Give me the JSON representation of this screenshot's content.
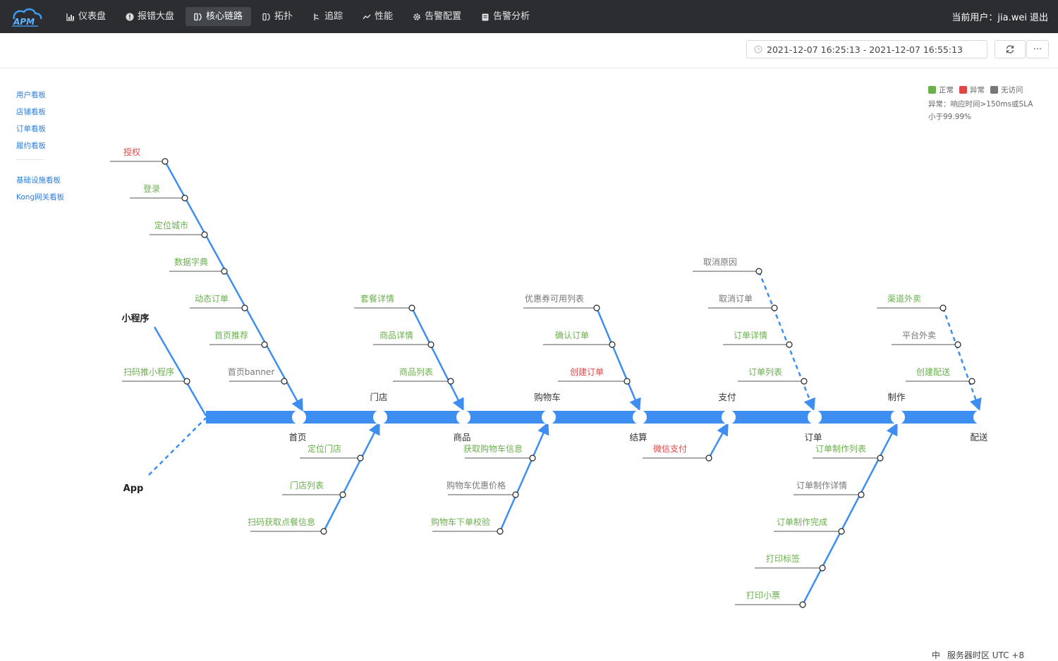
{
  "nav": {
    "logo": "APM",
    "items": [
      {
        "label": "仪表盘",
        "icon": "bar-chart-icon"
      },
      {
        "label": "报错大盘",
        "icon": "alert-circle-icon"
      },
      {
        "label": "核心链路",
        "icon": "link-icon",
        "active": true
      },
      {
        "label": "拓扑",
        "icon": "topology-icon"
      },
      {
        "label": "追踪",
        "icon": "trace-icon"
      },
      {
        "label": "性能",
        "icon": "trend-icon"
      },
      {
        "label": "告警配置",
        "icon": "gear-icon"
      },
      {
        "label": "告警分析",
        "icon": "clipboard-icon"
      }
    ],
    "user_label": "当前用户：",
    "user_name": "jia.wei",
    "logout": "退出"
  },
  "toolbar": {
    "time_range": "2021-12-07 16:25:13 - 2021-12-07 16:55:13",
    "refresh_icon": "refresh-icon",
    "more_label": "···"
  },
  "sidebar": {
    "group1": [
      "用户看板",
      "店铺看板",
      "订单看板",
      "履约看板"
    ],
    "group2": [
      "基础设施看板",
      "Kong网关看板"
    ]
  },
  "legend": {
    "normal": "正常",
    "abnormal": "异常",
    "no_access": "无访问",
    "colors": {
      "normal": "#6ab04c",
      "abnormal": "#e04848",
      "no_access": "#777777"
    },
    "note_line1": "异常：响应时间>150ms或SLA",
    "note_line2": "小于99.99%"
  },
  "diagram": {
    "spine_color": "#3d8ef0",
    "sources": {
      "mini_program": "小程序",
      "app": "App"
    },
    "main_nodes": [
      "首页",
      "门店",
      "商品",
      "购物车",
      "结算",
      "支付",
      "订单",
      "制作",
      "配送"
    ],
    "branches": {
      "home": [
        "授权",
        "登录",
        "定位城市",
        "数据字典",
        "动态订单",
        "首页推荐",
        "首页banner"
      ],
      "mini_program": [
        "扫码推小程序"
      ],
      "store": [
        "定位门店",
        "门店列表",
        "扫码获取点餐信息"
      ],
      "goods": [
        "套餐详情",
        "商品详情",
        "商品列表"
      ],
      "cart": [
        "获取购物车信息",
        "购物车优惠价格",
        "购物车下单校验"
      ],
      "checkout": [
        "优惠券可用列表",
        "确认订单",
        "创建订单"
      ],
      "payment": [
        "微信支付"
      ],
      "order": [
        "取消原因",
        "取消订单",
        "订单详情",
        "订单列表"
      ],
      "production": [
        "订单制作列表",
        "订单制作详情",
        "订单制作完成",
        "打印标签",
        "打印小票"
      ],
      "delivery": [
        "渠道外卖",
        "平台外卖",
        "创建配送"
      ]
    }
  },
  "footer": {
    "lang": "中",
    "timezone": "服务器时区 UTC +8"
  }
}
